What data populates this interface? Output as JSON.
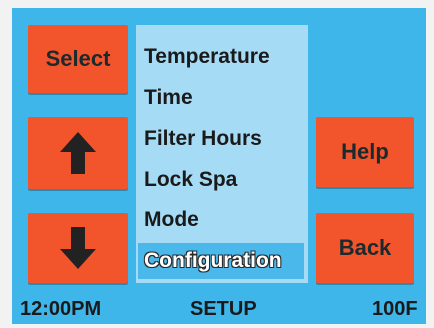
{
  "buttons": {
    "select_label": "Select",
    "up_icon": "arrow-up-icon",
    "down_icon": "arrow-down-icon",
    "help_label": "Help",
    "back_label": "Back"
  },
  "menu": {
    "items": [
      {
        "label": "Temperature",
        "selected": false
      },
      {
        "label": "Time",
        "selected": false
      },
      {
        "label": "Filter Hours",
        "selected": false
      },
      {
        "label": "Lock Spa",
        "selected": false
      },
      {
        "label": "Mode",
        "selected": false
      },
      {
        "label": "Configuration",
        "selected": true
      }
    ]
  },
  "status": {
    "time": "12:00PM",
    "mode": "SETUP",
    "temperature": "100F"
  },
  "colors": {
    "panel_background": "#3fb6ea",
    "button_background": "#f2542b",
    "menu_background": "#a6dbf6",
    "selected_item_background": "#4ab8ea"
  }
}
